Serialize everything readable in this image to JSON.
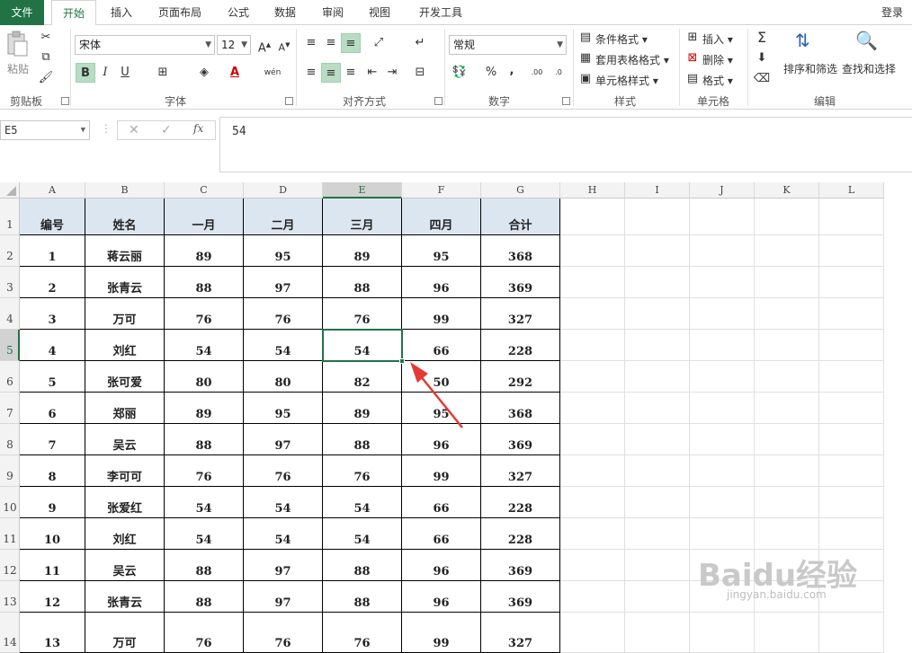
{
  "tabs": [
    "文件",
    "开始",
    "插入",
    "页面布局",
    "公式",
    "数据",
    "审阅",
    "视图",
    "开发工具"
  ],
  "login": "登录",
  "ribbon": {
    "clipboard": {
      "paste": "粘贴",
      "label": "剪贴板"
    },
    "font": {
      "name": "宋体",
      "size": "12",
      "bold": "B",
      "italic": "I",
      "underline": "U",
      "label": "字体"
    },
    "alignment": {
      "label": "对齐方式"
    },
    "number": {
      "format": "常规",
      "percent": "%",
      "comma": ",",
      "label": "数字"
    },
    "styles": {
      "conditional": "条件格式",
      "table": "套用表格格式",
      "cell": "单元格样式",
      "label": "样式"
    },
    "cells": {
      "insert": "插入",
      "delete": "删除",
      "format": "格式",
      "label": "单元格"
    },
    "editing": {
      "sort": "排序和筛选",
      "find": "查找和选择",
      "label": "编辑"
    }
  },
  "formula": {
    "namebox": "E5",
    "value": "54",
    "fx": "fx"
  },
  "columns": [
    "A",
    "B",
    "C",
    "D",
    "E",
    "F",
    "G",
    "H",
    "I",
    "J",
    "K",
    "L"
  ],
  "selected_cell": "E5",
  "header_row": [
    "编号",
    "姓名",
    "一月",
    "二月",
    "三月",
    "四月",
    "合计"
  ],
  "rows": [
    [
      "1",
      "蒋云丽",
      "89",
      "95",
      "89",
      "95",
      "368"
    ],
    [
      "2",
      "张青云",
      "88",
      "97",
      "88",
      "96",
      "369"
    ],
    [
      "3",
      "万可",
      "76",
      "76",
      "76",
      "99",
      "327"
    ],
    [
      "4",
      "刘红",
      "54",
      "54",
      "54",
      "66",
      "228"
    ],
    [
      "5",
      "张可爱",
      "80",
      "80",
      "82",
      "50",
      "292"
    ],
    [
      "6",
      "郑丽",
      "89",
      "95",
      "89",
      "95",
      "368"
    ],
    [
      "7",
      "吴云",
      "88",
      "97",
      "88",
      "96",
      "369"
    ],
    [
      "8",
      "李可可",
      "76",
      "76",
      "76",
      "99",
      "327"
    ],
    [
      "9",
      "张爱红",
      "54",
      "54",
      "54",
      "66",
      "228"
    ],
    [
      "10",
      "刘红",
      "54",
      "54",
      "54",
      "66",
      "228"
    ],
    [
      "11",
      "吴云",
      "88",
      "97",
      "88",
      "96",
      "369"
    ],
    [
      "12",
      "张青云",
      "88",
      "97",
      "88",
      "96",
      "369"
    ],
    [
      "13",
      "万可",
      "76",
      "76",
      "76",
      "99",
      "327"
    ]
  ],
  "row_numbers": [
    "1",
    "2",
    "3",
    "4",
    "5",
    "6",
    "7",
    "8",
    "9",
    "10",
    "11",
    "12",
    "13",
    "14"
  ],
  "watermark": {
    "brand": "Baidu经验",
    "url": "jingyan.baidu.com"
  },
  "colors": {
    "accent": "#217346",
    "header_fill": "#dce6f1",
    "arrow": "#e53935"
  }
}
